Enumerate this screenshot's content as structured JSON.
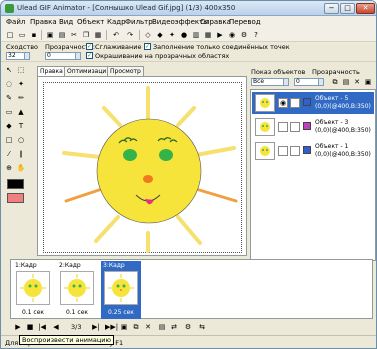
{
  "title": "Ulead GIF Animator - [Солнышко Ulead Gif.jpg] (1/3) 400x350",
  "window_controls": {
    "minimize": "−",
    "maximize": "□",
    "close": "✕"
  },
  "menu": [
    "Файл",
    "Правка",
    "Вид",
    "Объект",
    "Кадр",
    "Фильтр",
    "Видеоэффекты",
    "Справка",
    "Перевод"
  ],
  "options": {
    "similarity_label": "Сходство",
    "similarity_value": "32",
    "opacity_label": "Прозрачность:",
    "opacity_value": "0",
    "smoothing_label": "Сглаживание",
    "fill_connected_label": "Заполнение только соединённых точек",
    "paint_transparent_label": "Окрашивание на прозрачных областях"
  },
  "tabs": [
    "Правка",
    "Оптимизация",
    "Просмотр"
  ],
  "objects_panel": {
    "show_label": "Показ объектов",
    "opacity_label": "Прозрачность",
    "filter_value": "Все",
    "opacity_value": "0",
    "items": [
      {
        "name": "Объект - 5",
        "info": "(0,0)(@400,B:350)",
        "color": "#2f5fd0",
        "selected": true
      },
      {
        "name": "Объект - 3",
        "info": "(0,0)(@400,B:350)",
        "color": "#c040c0",
        "selected": false
      },
      {
        "name": "Объект - 1",
        "info": "(0,0)(@400,B:350)",
        "color": "#2f5fd0",
        "selected": false
      }
    ]
  },
  "frames": [
    {
      "label": "1:Кадр",
      "delay": "0.1 сек",
      "selected": false
    },
    {
      "label": "2:Кадр",
      "delay": "0.1 сек",
      "selected": false
    },
    {
      "label": "3:Кадр",
      "delay": "0.25 сек",
      "selected": true
    }
  ],
  "playbar": {
    "counter": "3/3"
  },
  "status": {
    "text": "Для справки нажмите клавишу F1",
    "tooltip": "Воспроизвести анимацию"
  },
  "icons": {
    "play": "▶",
    "stop": "■",
    "first": "|◀",
    "prev": "◀",
    "next": "▶|",
    "last": "▶▶|"
  },
  "colors": {
    "sun": "#f7e43a",
    "ray": "#f5e070",
    "ray_orange": "#f0a040",
    "selection": "#316ac5",
    "eye_green": "#33b34a",
    "nose": "#f07a20",
    "tongue": "#e03080",
    "fg_swatch": "#000000",
    "bg_swatch": "#f08080"
  }
}
